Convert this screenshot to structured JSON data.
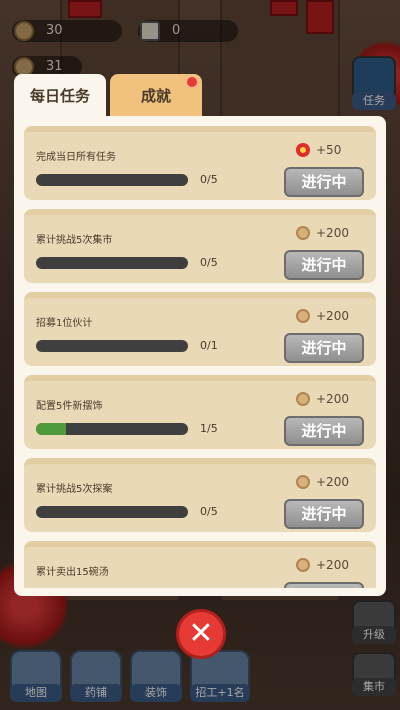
{
  "hud": {
    "coins": "30",
    "cards": "0",
    "level": "31"
  },
  "side": {
    "task_label": "任务",
    "upgrade_label": "升级",
    "market_label": "集市"
  },
  "bottom": [
    {
      "label": "地图"
    },
    {
      "label": "药铺"
    },
    {
      "label": "装饰"
    },
    {
      "label": "招工+1名"
    }
  ],
  "tabs": {
    "daily": "每日任务",
    "achievement": "成就"
  },
  "tasks": [
    {
      "name": "完成当日所有任务",
      "progress_text": "0/5",
      "progress": 0.0,
      "reward_icon": "flower-icon",
      "reward": "+50",
      "status": "进行中"
    },
    {
      "name": "累计挑战5次集市",
      "progress_text": "0/5",
      "progress": 0.0,
      "reward_icon": "coin-icon",
      "reward": "+200",
      "status": "进行中"
    },
    {
      "name": "招募1位伙计",
      "progress_text": "0/1",
      "progress": 0.0,
      "reward_icon": "coin-icon",
      "reward": "+200",
      "status": "进行中"
    },
    {
      "name": "配置5件新摆饰",
      "progress_text": "1/5",
      "progress": 0.2,
      "reward_icon": "coin-icon",
      "reward": "+200",
      "status": "进行中"
    },
    {
      "name": "累计挑战5次探案",
      "progress_text": "0/5",
      "progress": 0.0,
      "reward_icon": "coin-icon",
      "reward": "+200",
      "status": "进行中"
    },
    {
      "name": "累计卖出15碗汤",
      "progress_text": "",
      "progress": 0.0,
      "reward_icon": "coin-icon",
      "reward": "+200",
      "status": ""
    }
  ],
  "close_label": "✕"
}
